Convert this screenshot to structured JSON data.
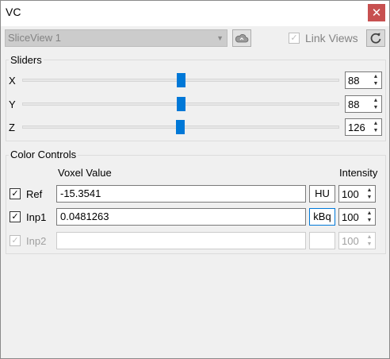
{
  "window": {
    "title": "VC",
    "close_glyph": "✕"
  },
  "toolbar": {
    "view_select": "SliceView 1",
    "link_views_label": "Link Views",
    "link_views_checked": true,
    "cloud_icon": "cloud-icon",
    "refresh_icon": "refresh-icon"
  },
  "sliders": {
    "title": "Sliders",
    "items": [
      {
        "label": "X",
        "value": "88",
        "fraction": 0.5
      },
      {
        "label": "Y",
        "value": "88",
        "fraction": 0.5
      },
      {
        "label": "Z",
        "value": "126",
        "fraction": 0.5
      }
    ]
  },
  "color_controls": {
    "title": "Color Controls",
    "voxel_header": "Voxel Value",
    "intensity_header": "Intensity",
    "rows": [
      {
        "label": "Ref",
        "checked": true,
        "voxel_value": "-15.3541",
        "unit": "HU",
        "intensity": "100",
        "enabled": true
      },
      {
        "label": "Inp1",
        "checked": true,
        "voxel_value": "0.0481263",
        "unit": "kBq",
        "intensity": "100",
        "enabled": true
      },
      {
        "label": "Inp2",
        "checked": true,
        "voxel_value": "",
        "unit": "",
        "intensity": "100",
        "enabled": false
      }
    ]
  },
  "colors": {
    "accent": "#0078d7",
    "close": "#c75050"
  }
}
